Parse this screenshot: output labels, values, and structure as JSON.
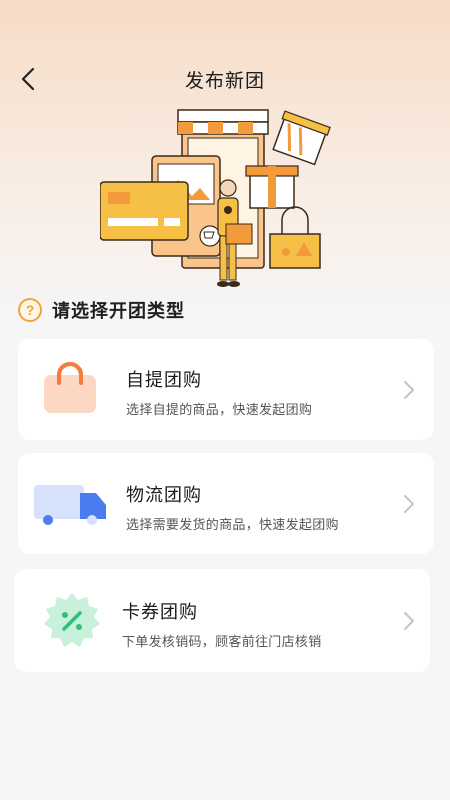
{
  "header": {
    "title": "发布新团",
    "back_icon": "chevron-left-icon"
  },
  "section": {
    "title": "请选择开团类型",
    "icon": "question-icon"
  },
  "options": [
    {
      "title": "自提团购",
      "subtitle": "选择自提的商品，快速发起团购",
      "icon": "shopping-bag-icon",
      "icon_color": "#f47c3c"
    },
    {
      "title": "物流团购",
      "subtitle": "选择需要发货的商品，快速发起团购",
      "icon": "delivery-truck-icon",
      "icon_color": "#4a7cf0"
    },
    {
      "title": "卡券团购",
      "subtitle": "下单发核销码，顾客前往门店核销",
      "icon": "coupon-badge-icon",
      "icon_color": "#2fbf7a"
    }
  ],
  "colors": {
    "accent": "#f0a23b",
    "background": "#f6f6f6"
  }
}
